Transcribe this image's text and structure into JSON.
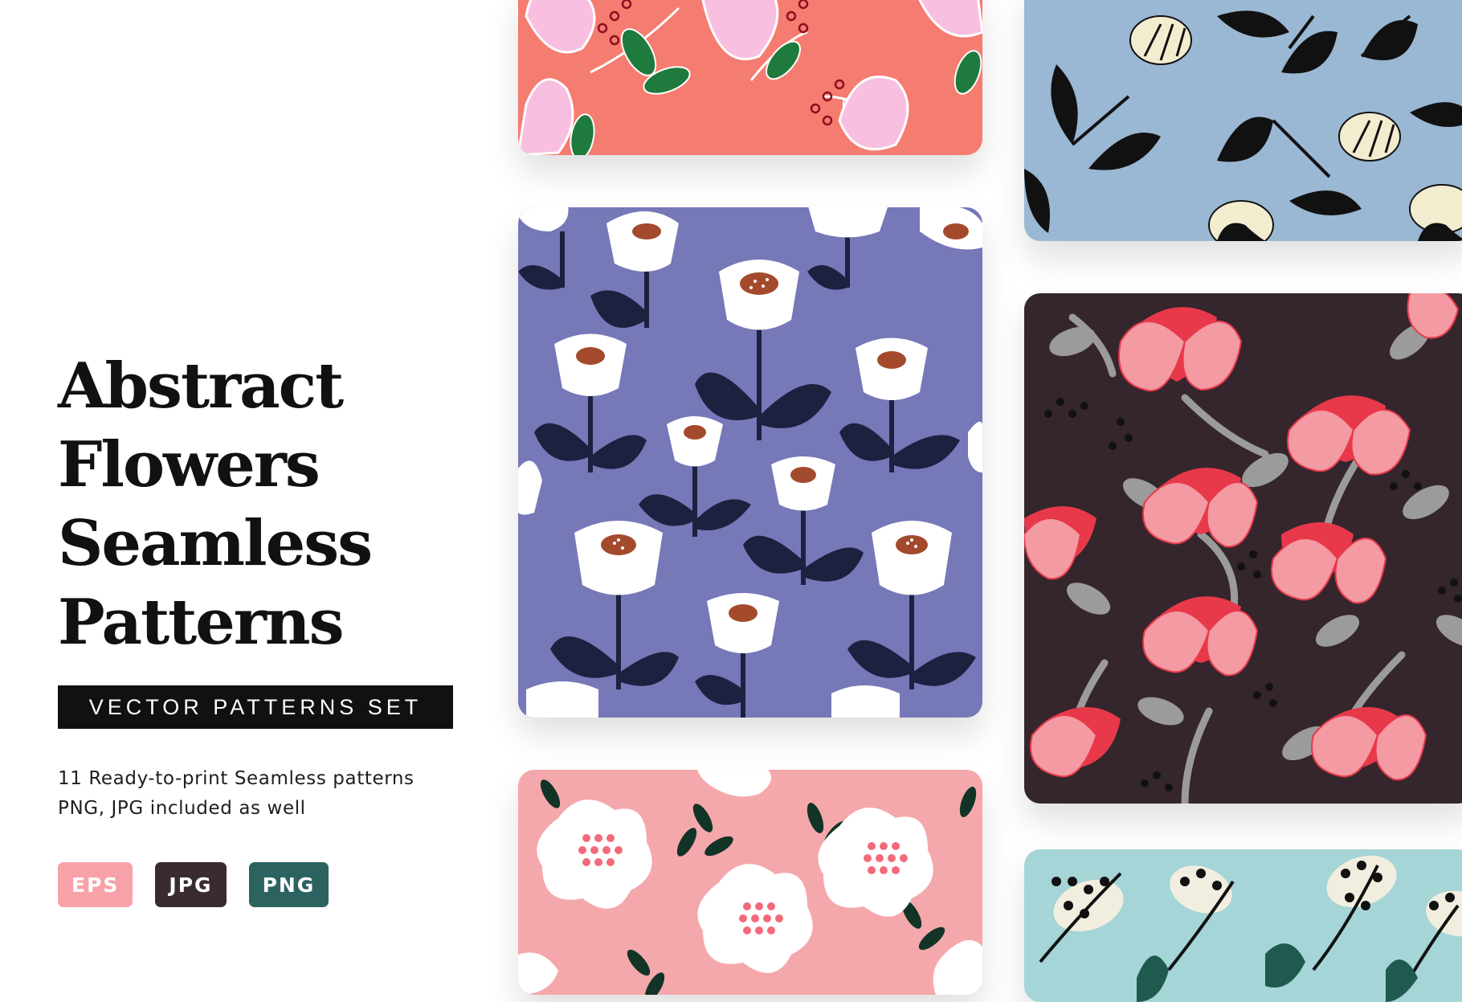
{
  "title_lines": [
    "Abstract",
    "Flowers",
    "Seamless",
    "Patterns"
  ],
  "banner_label": "VECTOR PATTERNS SET",
  "description_lines": [
    "11 Ready-to-print Seamless patterns",
    "PNG, JPG included as well"
  ],
  "badges": [
    {
      "label": "EPS",
      "color": "#f7a2a8"
    },
    {
      "label": "JPG",
      "color": "#3a2b33"
    },
    {
      "label": "PNG",
      "color": "#2c6360"
    }
  ],
  "patterns": [
    {
      "name": "coral-tulip-pattern",
      "background": "#f57c70",
      "flower": "#f9bfe0",
      "leaf": "#1f7a3d"
    },
    {
      "name": "blue-bud-pattern",
      "background": "#9ab7d3",
      "flower": "#f3edd0",
      "leaf": "#111111"
    },
    {
      "name": "periwinkle-tulip-pattern",
      "background": "#7678b8",
      "flower": "#ffffff",
      "leaf": "#1d2140"
    },
    {
      "name": "dark-pink-blossom-pattern",
      "background": "#34262c",
      "flower": "#f39aa3",
      "accent": "#e8394a",
      "leaf": "#9b9b9b"
    },
    {
      "name": "pink-white-flower-pattern",
      "background": "#f5a8ac",
      "flower": "#ffffff",
      "leaf": "#123426"
    },
    {
      "name": "mint-berry-pattern",
      "background": "#a5d5d6",
      "flower": "#f1eee0",
      "leaf": "#111111"
    }
  ]
}
